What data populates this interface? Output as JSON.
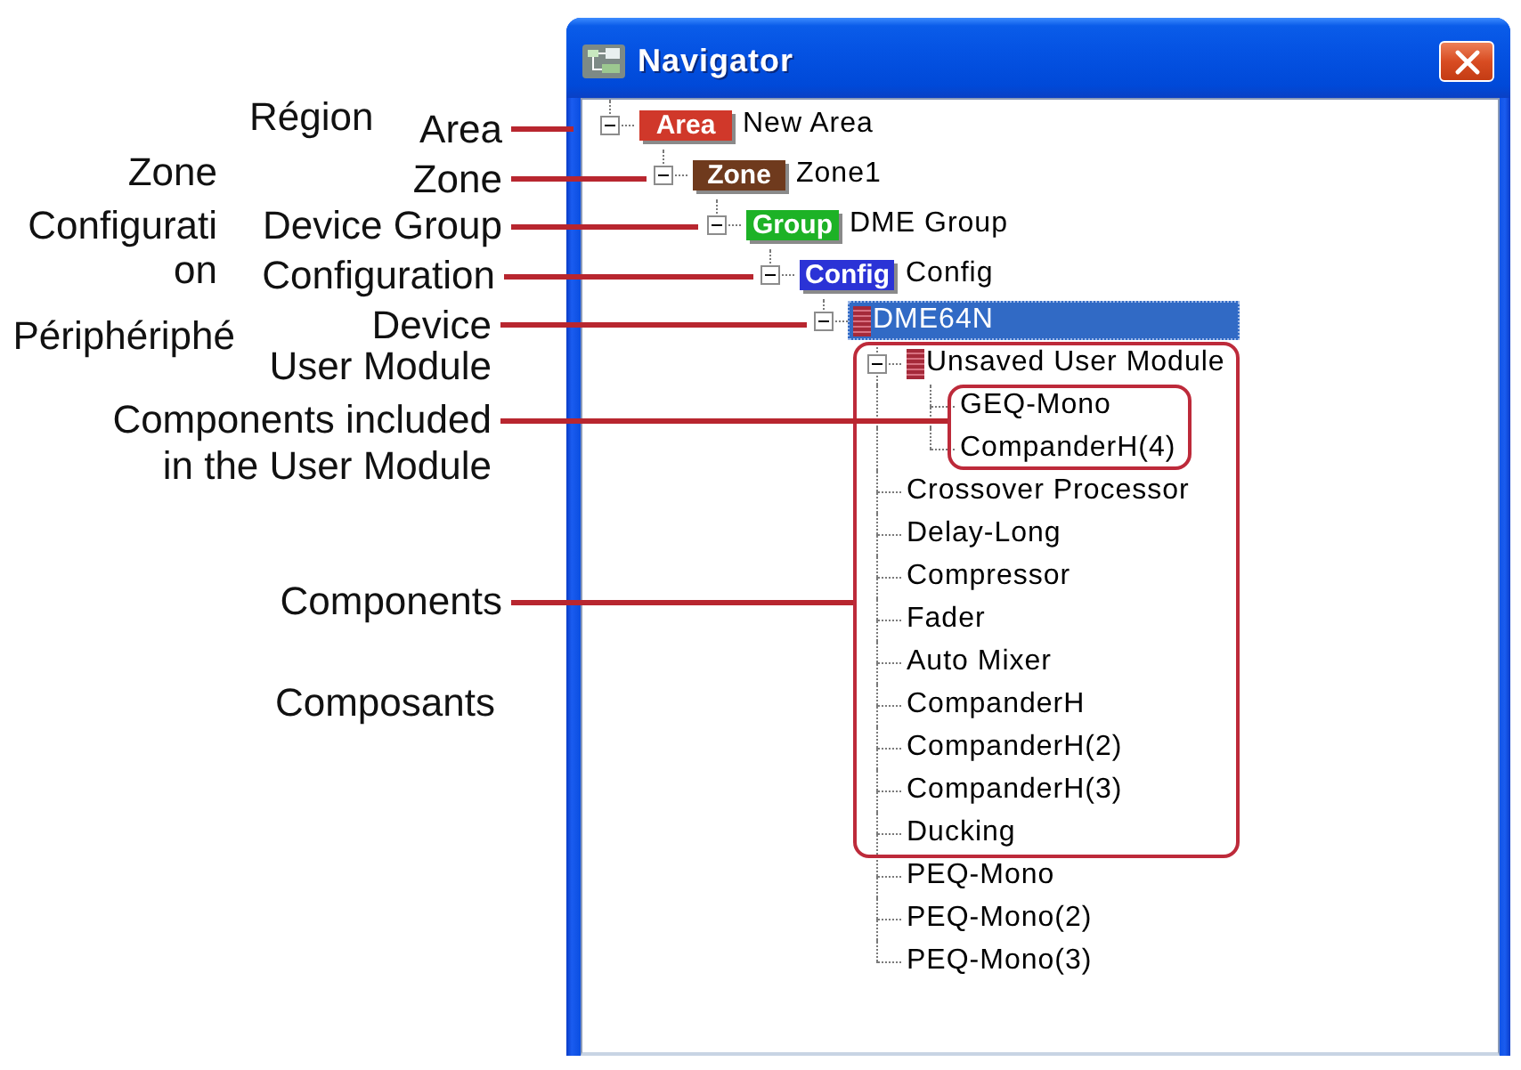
{
  "window": {
    "title": "Navigator"
  },
  "tree": [
    {
      "label": "New Area",
      "kind": "tag",
      "tag": {
        "text": "Area",
        "color": "#d0382a"
      },
      "expanded": true,
      "selected": false,
      "children": [
        {
          "label": "Zone1",
          "kind": "tag",
          "tag": {
            "text": "Zone",
            "color": "#6f3a1d"
          },
          "expanded": true,
          "selected": false,
          "children": [
            {
              "label": "DME Group",
              "kind": "tag",
              "tag": {
                "text": "Group",
                "color": "#1db226"
              },
              "expanded": true,
              "selected": false,
              "children": [
                {
                  "label": "Config",
                  "kind": "tag",
                  "tag": {
                    "text": "Config",
                    "color": "#2b33d6"
                  },
                  "expanded": true,
                  "selected": false,
                  "children": [
                    {
                      "label": "DME64N",
                      "kind": "device",
                      "expanded": true,
                      "selected": true,
                      "children": [
                        {
                          "label": "Unsaved User Module",
                          "kind": "device",
                          "expanded": true,
                          "selected": false,
                          "children": [
                            {
                              "label": "GEQ-Mono",
                              "kind": "component",
                              "selected": false
                            },
                            {
                              "label": "CompanderH(4)",
                              "kind": "component",
                              "selected": false
                            }
                          ]
                        },
                        {
                          "label": "Crossover Processor",
                          "kind": "component",
                          "selected": false
                        },
                        {
                          "label": "Delay-Long",
                          "kind": "component",
                          "selected": false
                        },
                        {
                          "label": "Compressor",
                          "kind": "component",
                          "selected": false
                        },
                        {
                          "label": "Fader",
                          "kind": "component",
                          "selected": false
                        },
                        {
                          "label": "Auto Mixer",
                          "kind": "component",
                          "selected": false
                        },
                        {
                          "label": "CompanderH",
                          "kind": "component",
                          "selected": false
                        },
                        {
                          "label": "CompanderH(2)",
                          "kind": "component",
                          "selected": false
                        },
                        {
                          "label": "CompanderH(3)",
                          "kind": "component",
                          "selected": false
                        },
                        {
                          "label": "Ducking",
                          "kind": "component",
                          "selected": false
                        },
                        {
                          "label": "PEQ-Mono",
                          "kind": "component",
                          "selected": false
                        },
                        {
                          "label": "PEQ-Mono(2)",
                          "kind": "component",
                          "selected": false
                        },
                        {
                          "label": "PEQ-Mono(3)",
                          "kind": "component",
                          "selected": false
                        }
                      ]
                    }
                  ]
                }
              ]
            }
          ]
        }
      ]
    }
  ],
  "callouts": [
    {
      "text": "Area",
      "leader": true
    },
    {
      "text": "Zone",
      "leader": true
    },
    {
      "text": "Device Group",
      "leader": true
    },
    {
      "text": "Configuration",
      "leader": true
    },
    {
      "text": "Device",
      "leader": true
    },
    {
      "text": "User Module",
      "leader": false
    },
    {
      "text": "Components included in the User Module",
      "leader": true
    },
    {
      "text": "Components",
      "leader": true
    }
  ],
  "translations": [
    {
      "text": "Région"
    },
    {
      "text": "Zone"
    },
    {
      "text": "Configuration"
    },
    {
      "text": "Périphériphé"
    },
    {
      "text": "Composants"
    }
  ]
}
